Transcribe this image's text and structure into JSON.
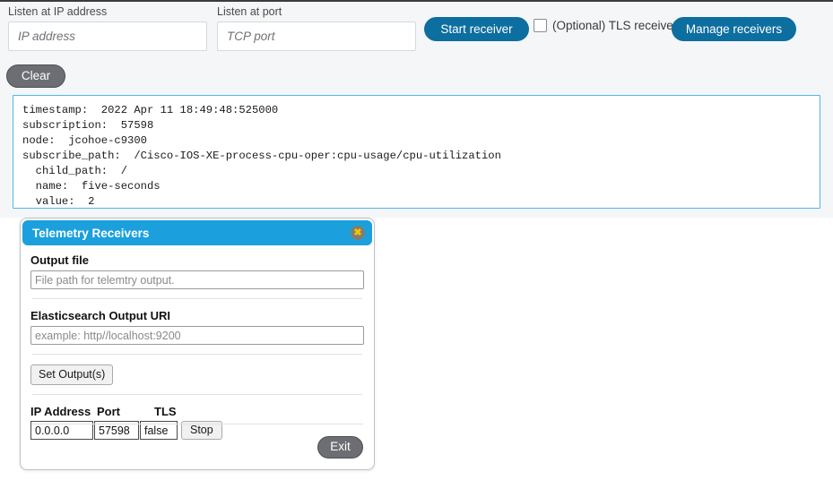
{
  "top_panel": {
    "ip_field": {
      "label": "Listen at IP address",
      "placeholder": "IP address",
      "value": ""
    },
    "port_field": {
      "label": "Listen at port",
      "placeholder": "TCP port",
      "value": ""
    },
    "start_button": "Start receiver",
    "tls_checkbox_label": "(Optional) TLS receiver",
    "tls_checkbox_checked": "false",
    "manage_button": "Manage receivers",
    "clear_button": "Clear",
    "accent_blue": "#0d6ea0",
    "log_border_color": "#51b6e8",
    "panel_background": "#f5f6f7"
  },
  "log": {
    "lines": [
      "timestamp:  2022 Apr 11 18:49:48:525000",
      "subscription:  57598",
      "node:  jcohoe-c9300",
      "subscribe_path:  /Cisco-IOS-XE-process-cpu-oper:cpu-usage/cpu-utilization",
      "  child_path:  /",
      "  name:  five-seconds",
      "  value:  2"
    ],
    "text": "timestamp:  2022 Apr 11 18:49:48:525000\nsubscription:  57598\nnode:  jcohoe-c9300\nsubscribe_path:  /Cisco-IOS-XE-process-cpu-oper:cpu-usage/cpu-utilization\n  child_path:  /\n  name:  five-seconds\n  value:  2",
    "fields": {
      "timestamp": "2022 Apr 11 18:49:48:525000",
      "subscription": "57598",
      "node": "jcohoe-c9300",
      "subscribe_path": "/Cisco-IOS-XE-process-cpu-oper:cpu-usage/cpu-utilization",
      "child_path": "/",
      "name": "five-seconds",
      "value": "2"
    }
  },
  "dialog": {
    "title": "Telemetry Receivers",
    "close_glyph": "✖",
    "header_color": "#1ba0dd",
    "output_file": {
      "label": "Output file",
      "placeholder": "File path for telemtry output.",
      "value": ""
    },
    "elasticsearch": {
      "label": "Elasticsearch Output URI",
      "placeholder": "example: http//localhost:9200",
      "value": ""
    },
    "set_outputs_button": "Set Output(s)",
    "receivers_table": {
      "headers": [
        "IP Address",
        "Port",
        "TLS"
      ],
      "rows": [
        {
          "ip_address": "0.0.0.0",
          "port": "57598",
          "tls": "false",
          "action_label": "Stop"
        }
      ]
    },
    "exit_button": "Exit"
  }
}
